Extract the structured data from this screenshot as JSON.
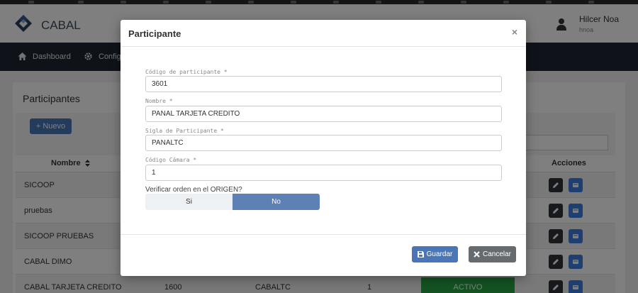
{
  "app": {
    "brand": "CABAL",
    "user_name": "Hilcer Noa",
    "user_login": "hnoa"
  },
  "nav": {
    "items": [
      {
        "label": "Dashboard",
        "icon": "home-icon"
      },
      {
        "label": "Config",
        "icon": "gear-icon"
      }
    ]
  },
  "page": {
    "title": "Participantes",
    "new_button": "Nuevo"
  },
  "table": {
    "columns": {
      "name": "Nombre",
      "actions": "Acciones"
    },
    "rows": [
      {
        "name": "SICOOP"
      },
      {
        "name": "pruebas"
      },
      {
        "name": "SICOOP PRUEBAS"
      },
      {
        "name": "CABAL DIMO"
      },
      {
        "name": "CABAL TARJETA CREDITO",
        "code": "1600",
        "sigla": "CABALTC",
        "camara": "1",
        "status": "ACTIVO"
      }
    ]
  },
  "modal": {
    "title": "Participante",
    "close": "×",
    "fields": {
      "codigo": {
        "label": "Código de participante *",
        "value": "3601"
      },
      "nombre": {
        "label": "Nombre *",
        "value": "PANAL TARJETA CREDITO"
      },
      "sigla": {
        "label": "Sigla de Participante *",
        "value": "PANALTC"
      },
      "camara": {
        "label": "Código Cámara *",
        "value": "1"
      }
    },
    "verify": {
      "label": "Verificar orden en el ORIGEN?",
      "options": [
        "Si",
        "No"
      ],
      "selected": "No"
    },
    "save": "Guardar",
    "cancel": "Cancelar"
  },
  "colors": {
    "primary": "#4a76b8",
    "navbar": "#1f2732",
    "active_status": "#28a745",
    "toggle_selected": "#5e81b5"
  }
}
